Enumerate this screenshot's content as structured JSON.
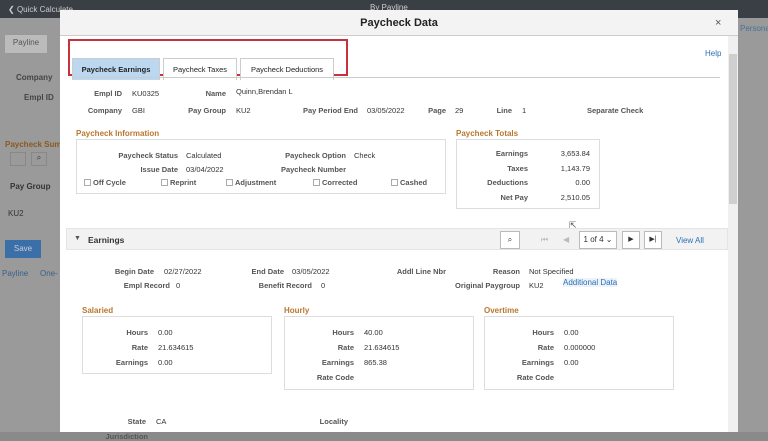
{
  "background": {
    "back_label": "Quick Calculate",
    "page_title": "By Payline",
    "personalize": "Personalize",
    "tab_payline": "Payline",
    "company_label": "Company",
    "emplid_label": "Empl ID",
    "summary_title": "Paycheck Summary",
    "pay_group_col": "Pay Group",
    "pay_group_val": "KU2",
    "save_label": "Save",
    "link_payline": "Payline",
    "link_one": "One-"
  },
  "modal": {
    "title": "Paycheck Data",
    "close": "×",
    "help": "Help",
    "tabs": [
      "Paycheck Earnings",
      "Paycheck Taxes",
      "Paycheck Deductions"
    ],
    "header": {
      "emplid_label": "Empl ID",
      "emplid": "KU0325",
      "name_label": "Name",
      "name": "Quinn,Brendan L",
      "company_label": "Company",
      "company": "GBI",
      "paygroup_label": "Pay Group",
      "paygroup": "KU2",
      "ppe_label": "Pay Period End",
      "ppe": "03/05/2022",
      "page_label": "Page",
      "page": "29",
      "line_label": "Line",
      "line": "1",
      "separate_check": "Separate Check"
    },
    "info": {
      "title": "Paycheck Information",
      "status_label": "Paycheck Status",
      "status": "Calculated",
      "option_label": "Paycheck Option",
      "option": "Check",
      "issue_label": "Issue Date",
      "issue": "03/04/2022",
      "number_label": "Paycheck Number",
      "checkboxes": [
        "Off Cycle",
        "Reprint",
        "Adjustment",
        "Corrected",
        "Cashed"
      ]
    },
    "totals": {
      "title": "Paycheck Totals",
      "rows": [
        {
          "label": "Earnings",
          "value": "3,653.84"
        },
        {
          "label": "Taxes",
          "value": "1,143.79"
        },
        {
          "label": "Deductions",
          "value": "0.00"
        },
        {
          "label": "Net Pay",
          "value": "2,510.05"
        }
      ]
    },
    "earnings": {
      "title": "Earnings",
      "pager": "1 of 4",
      "view_all": "View All",
      "begin_label": "Begin Date",
      "begin": "02/27/2022",
      "end_label": "End Date",
      "end": "03/05/2022",
      "addl_label": "Addl Line Nbr",
      "reason_label": "Reason",
      "reason": "Not Specified",
      "emplrec_label": "Empl Record",
      "emplrec": "0",
      "benrec_label": "Benefit Record",
      "benrec": "0",
      "origpg_label": "Original Paygroup",
      "origpg": "KU2",
      "additional": "Additional Data",
      "salaried": {
        "title": "Salaried",
        "hours": "0.00",
        "rate": "21.634615",
        "earnings": "0.00"
      },
      "hourly": {
        "title": "Hourly",
        "hours": "40.00",
        "rate": "21.634615",
        "earnings": "865.38"
      },
      "overtime": {
        "title": "Overtime",
        "hours": "0.00",
        "rate": "0.000000",
        "earnings": "0.00"
      },
      "labels": {
        "hours": "Hours",
        "rate": "Rate",
        "earnings": "Earnings",
        "rate_code": "Rate Code"
      },
      "state_label": "State",
      "state": "CA",
      "locality_label": "Locality",
      "jurisdiction_label": "Jurisdiction"
    }
  }
}
